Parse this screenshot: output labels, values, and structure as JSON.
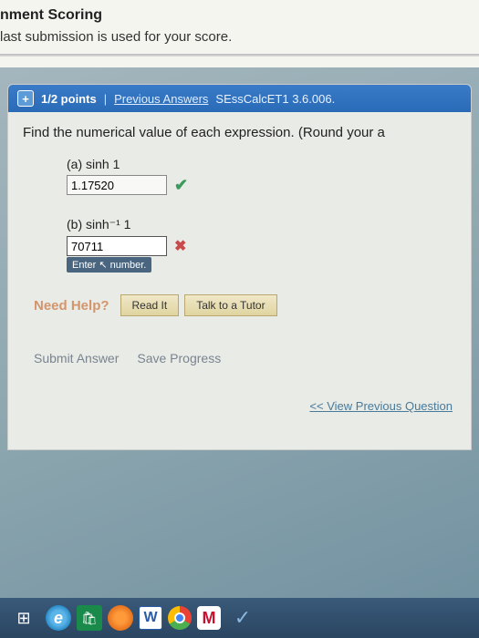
{
  "header": {
    "title": "nment Scoring",
    "subtitle": "last submission is used for your score."
  },
  "pointsBar": {
    "points": "1/2 points",
    "prevLink": "Previous Answers",
    "reference": "SEssCalcET1 3.6.006."
  },
  "question": {
    "prompt": "Find the numerical value of each expression. (Round your a",
    "parts": {
      "a": {
        "label": "(a)    sinh 1",
        "value": "1.17520"
      },
      "b": {
        "label": "(b)    sinh⁻¹ 1",
        "value": "70711"
      }
    },
    "tooltip": "Enter ↖ number."
  },
  "help": {
    "label": "Need Help?",
    "readBtn": "Read It",
    "tutorBtn": "Talk to a Tutor"
  },
  "actions": {
    "submit": "Submit Answer",
    "save": "Save Progress"
  },
  "nav": {
    "prevQuestion": "<< View Previous Question"
  },
  "taskbar": {
    "win": "⊞",
    "ie": "e",
    "store": "🛍",
    "word": "W",
    "mcafee": "M",
    "shield": "✓"
  }
}
